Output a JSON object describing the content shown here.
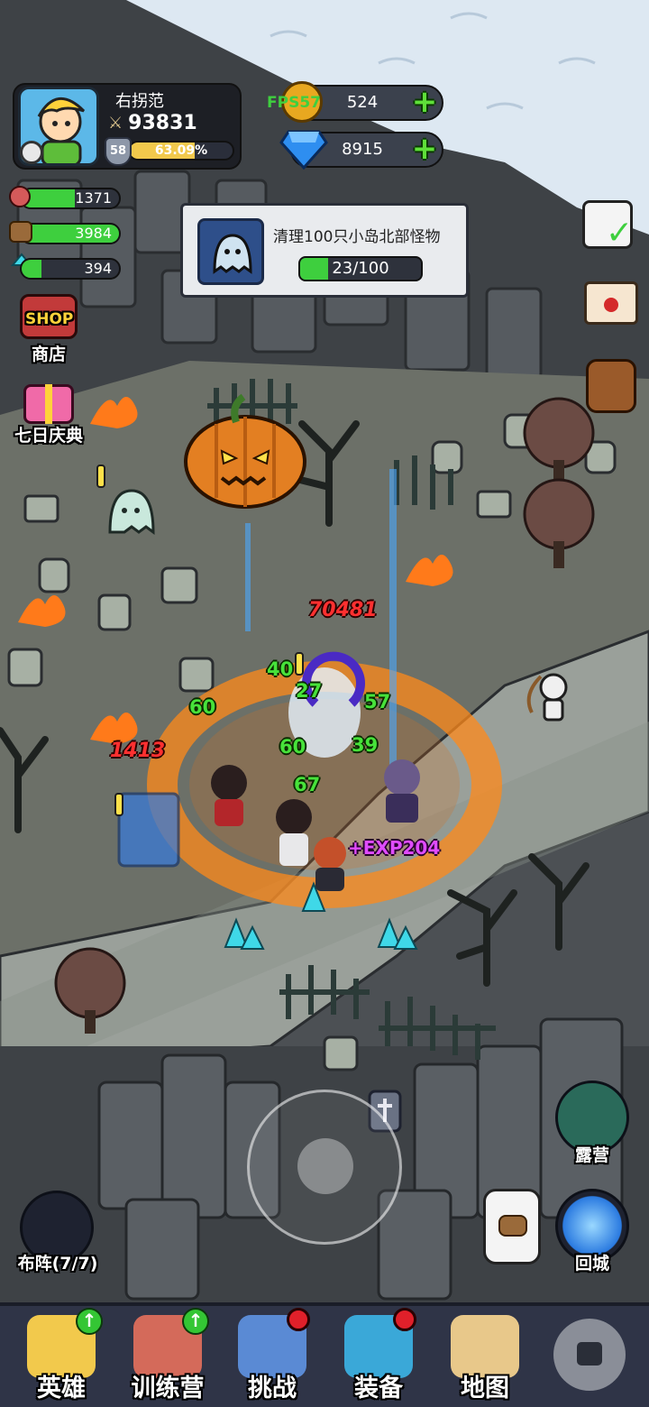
{
  "player": {
    "name": "右拐范",
    "power": "93831",
    "level": "58",
    "exp_percent_text": "63.09%",
    "exp_fraction": 0.6309
  },
  "fps_label": "FPS57",
  "currencies": {
    "gold": {
      "value": "524",
      "plus": "+"
    },
    "diamond": {
      "value": "8915",
      "plus": "+"
    }
  },
  "resources": [
    {
      "name": "meat",
      "value": "1371",
      "fill": 0.55
    },
    {
      "name": "wood",
      "value": "3984",
      "fill": 1.0
    },
    {
      "name": "crystal",
      "value": "394",
      "fill": 0.2
    }
  ],
  "side_buttons": {
    "shop_badge": "SHOP",
    "shop": "商店",
    "seven_day": "七日庆典"
  },
  "quest": {
    "title": "清理100只小岛北部怪物",
    "progress_text": "23/100",
    "progress_fraction": 0.23
  },
  "combat_text": {
    "dmg_top": "70481",
    "dmg_left": "1413",
    "heals": [
      "40",
      "60",
      "27",
      "57",
      "60",
      "39",
      "67"
    ],
    "exp_gain": "+EXP204"
  },
  "right_buttons": {
    "camp": "露营",
    "return_city": "回城"
  },
  "formation": "布阵(7/7)",
  "nav": [
    {
      "label": "英雄",
      "badge": "up"
    },
    {
      "label": "训练营",
      "badge": "up"
    },
    {
      "label": "挑战",
      "badge": "dot"
    },
    {
      "label": "装备",
      "badge": "dot"
    },
    {
      "label": "地图",
      "badge": "none"
    },
    {
      "label": "",
      "badge": "lock"
    }
  ],
  "colors": {
    "ground": "#4a4e52",
    "snow": "#dde8f2",
    "bar_green": "#3ecf3e",
    "exp_yellow": "#f2c94c",
    "nav_bg": "#2f3447"
  }
}
